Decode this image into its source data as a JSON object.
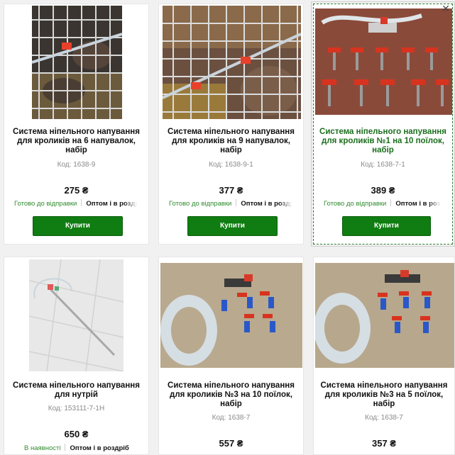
{
  "close_symbol": "✕",
  "products": [
    {
      "title": "Система нiпельного напування для кроликiв на 6 напувалок, набiр",
      "code": "Код: 1638-9",
      "price": "275 ₴",
      "status": "Готово до вiдправки",
      "wholesale": "Оптом i в роздрiб",
      "buy_label": "Купити"
    },
    {
      "title": "Система нiпельного напування для кроликiв на 9 напувалок, набiр",
      "code": "Код: 1638-9-1",
      "price": "377 ₴",
      "status": "Готово до вiдправки",
      "wholesale": "Оптом i в роздрiб",
      "buy_label": "Купити"
    },
    {
      "title": "Система нiпельного напування для кроликiв №1 на 10 поїлок, набiр",
      "code": "Код: 1638-7-1",
      "price": "389 ₴",
      "status": "Готово до вiдправки",
      "wholesale": "Оптом i в роздрiб",
      "buy_label": "Купити"
    },
    {
      "title": "Система нiпельного напування для нутрiй",
      "code": "Код: 153111-7-1Н",
      "price": "650 ₴",
      "status": "В наявностi",
      "wholesale": "Оптом i в роздрiб"
    },
    {
      "title": "Система нiпельного напування для кроликiв №3 на 10 поїлок, набiр",
      "code": "Код: 1638-7",
      "price": "557 ₴"
    },
    {
      "title": "Система нiпельного напування для кроликiв №3 на 5 поїлок, набiр",
      "code": "Код: 1638-7",
      "price": "357 ₴"
    }
  ],
  "colors": {
    "buy_button": "#0f7d11",
    "status_green": "#2e8b2e",
    "title_hover": "#1b6e1d"
  }
}
